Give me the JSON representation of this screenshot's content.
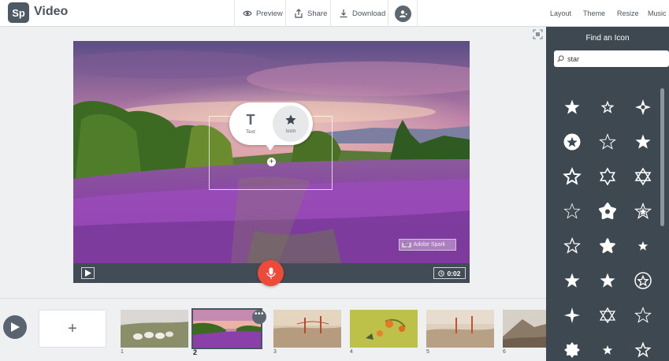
{
  "app": {
    "logo": "Sp",
    "name": "Video"
  },
  "toolbar": {
    "preview": "Preview",
    "share": "Share",
    "download": "Download",
    "menu": [
      "Layout",
      "Theme",
      "Resize",
      "Music"
    ]
  },
  "popup": {
    "text_option": "Text",
    "text_glyph": "T",
    "icon_option": "Icon"
  },
  "watermark": {
    "badge": "Sp",
    "text": "Adobe Spark"
  },
  "player": {
    "time": "0:02"
  },
  "timeline": {
    "add_label": "+",
    "slides": [
      "1",
      "2",
      "3",
      "4",
      "5",
      "6"
    ],
    "active_slide": 2,
    "more_label": "•••"
  },
  "panel": {
    "title": "Find an Icon",
    "search_value": "star",
    "icons": [
      "star-solid-icon",
      "star-outline-small-icon",
      "star-four-point-circle-icon",
      "star-in-circle-icon",
      "star-outline-icon",
      "star-solid-icon",
      "star-outline-bold-icon",
      "star-of-david-outline-icon",
      "star-of-david-icon",
      "star-outline-thin-icon",
      "star-flower-icon",
      "star-outline-double-icon",
      "star-sketch-icon",
      "star-rounded-solid-icon",
      "star-small-solid-icon",
      "star-solid-icon",
      "star-solid-icon",
      "star-circle-outline-icon",
      "star-four-point-icon",
      "star-of-david-triangle-icon",
      "star-outline-icon",
      "starburst-icon",
      "star-small-solid-icon",
      "star-outline-sharp-icon"
    ]
  },
  "colors": {
    "accent": "#ee4a3a",
    "panel": "#3e4851",
    "toolbar_text": "#4a5560"
  }
}
